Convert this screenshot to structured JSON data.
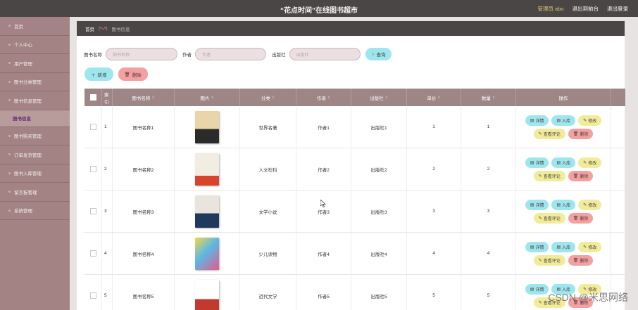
{
  "header": {
    "title": "“花点时间”在线图书超市",
    "admin": "管理员 abo",
    "link1": "退出到前台",
    "link2": "退出登录"
  },
  "sidebar": {
    "items": [
      "首页",
      "个人中心",
      "用户管理",
      "图书分类管理",
      "图书信息管理"
    ],
    "sub": "图书信息",
    "items2": [
      "图书购买管理",
      "订单发货管理",
      "图书入库管理",
      "留言板管理",
      "系统管理"
    ]
  },
  "breadcrumb": {
    "home": "首页",
    "sep": "(•ᴗ•)",
    "current": "图书信息"
  },
  "search": {
    "name_label": "图书名称",
    "name_placeholder": "图书名称",
    "author_label": "作者",
    "author_placeholder": "作者",
    "publisher_label": "出版社",
    "publisher_placeholder": "出版社",
    "button": "查询"
  },
  "actions": {
    "add": "新增",
    "delete": "删除"
  },
  "columns": [
    "索引",
    "图书名称",
    "图片",
    "分类",
    "作者",
    "出版社",
    "单价",
    "数量",
    "操作"
  ],
  "rows": [
    {
      "idx": "1",
      "name": "图书名称1",
      "category": "世界名著",
      "author": "作者1",
      "publisher": "出版社1",
      "price": "1",
      "qty": "1"
    },
    {
      "idx": "2",
      "name": "图书名称2",
      "category": "人文社科",
      "author": "作者2",
      "publisher": "出版社2",
      "price": "2",
      "qty": "2"
    },
    {
      "idx": "3",
      "name": "图书名称3",
      "category": "文学小说",
      "author": "作者3",
      "publisher": "出版社3",
      "price": "3",
      "qty": "3"
    },
    {
      "idx": "4",
      "name": "图书名称4",
      "category": "少儿读物",
      "author": "作者4",
      "publisher": "出版社4",
      "price": "4",
      "qty": "4"
    },
    {
      "idx": "5",
      "name": "图书名称5",
      "category": "近代文学",
      "author": "作者5",
      "publisher": "出版社5",
      "price": "5",
      "qty": "5"
    }
  ],
  "ops": {
    "detail": "详情",
    "stock": "入库",
    "edit": "修改",
    "comments": "查看评论",
    "delete": "删除"
  },
  "watermark": "CSDN @米思网络",
  "colors": {
    "sidebar": "#a38383",
    "header": "#4b4646",
    "cyan": "#9ee6ee",
    "yellow": "#f1ec9a",
    "pink": "#f4a0a0"
  }
}
